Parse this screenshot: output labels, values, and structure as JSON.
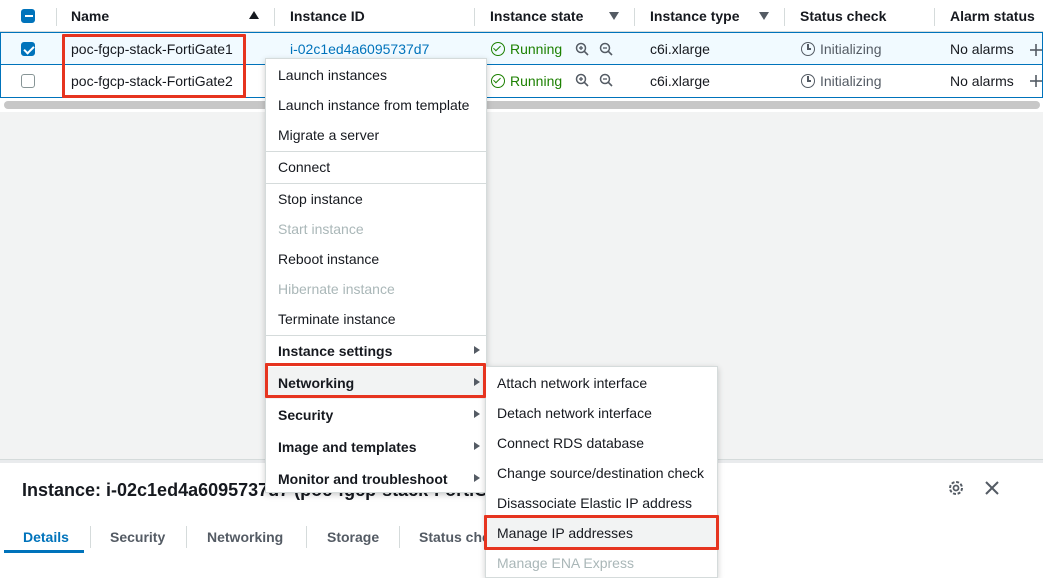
{
  "table": {
    "columns": {
      "name": "Name",
      "instance_id": "Instance ID",
      "instance_state": "Instance state",
      "instance_type": "Instance type",
      "status_check": "Status check",
      "alarm_status": "Alarm status"
    },
    "rows": [
      {
        "name": "poc-fgcp-stack-FortiGate1",
        "instance_id": "i-02c1ed4a6095737d7",
        "state": "Running",
        "type": "c6i.xlarge",
        "status_check": "Initializing",
        "alarm_status": "No alarms",
        "selected": true
      },
      {
        "name": "poc-fgcp-stack-FortiGate2",
        "instance_id": "",
        "state": "Running",
        "type": "c6i.xlarge",
        "status_check": "Initializing",
        "alarm_status": "No alarms",
        "selected": false
      }
    ]
  },
  "context_menu": {
    "items": [
      {
        "label": "Launch instances"
      },
      {
        "label": "Launch instance from template"
      },
      {
        "label": "Migrate a server"
      },
      {
        "label": "Connect"
      },
      {
        "label": "Stop instance"
      },
      {
        "label": "Start instance"
      },
      {
        "label": "Reboot instance"
      },
      {
        "label": "Hibernate instance"
      },
      {
        "label": "Terminate instance"
      },
      {
        "label": "Instance settings"
      },
      {
        "label": "Networking"
      },
      {
        "label": "Security"
      },
      {
        "label": "Image and templates"
      },
      {
        "label": "Monitor and troubleshoot"
      }
    ]
  },
  "submenu": {
    "items": [
      {
        "label": "Attach network interface"
      },
      {
        "label": "Detach network interface"
      },
      {
        "label": "Connect RDS database"
      },
      {
        "label": "Change source/destination check"
      },
      {
        "label": "Disassociate Elastic IP address"
      },
      {
        "label": "Manage IP addresses"
      },
      {
        "label": "Manage ENA Express"
      }
    ]
  },
  "details": {
    "title": "Instance: i-02c1ed4a6095737d7 (poc-fgcp-stack-FortiGate1)",
    "tabs": [
      "Details",
      "Security",
      "Networking",
      "Storage",
      "Status checks"
    ]
  },
  "colors": {
    "accent": "#0073bb",
    "running": "#1d8102",
    "highlight_box": "#e6341f"
  }
}
